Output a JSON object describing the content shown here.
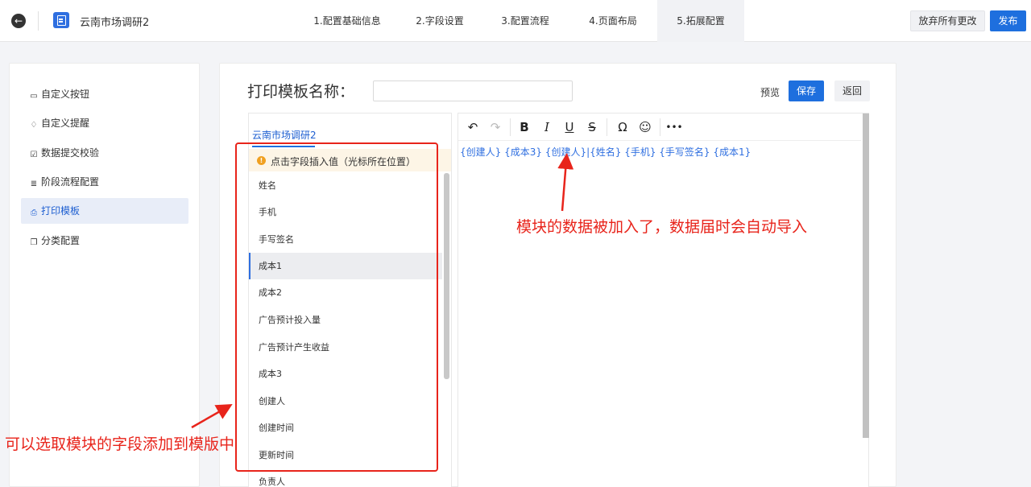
{
  "header": {
    "app_title": "云南市场调研2",
    "steps": [
      {
        "label": "1.配置基础信息",
        "active": false
      },
      {
        "label": "2.字段设置",
        "active": false
      },
      {
        "label": "3.配置流程",
        "active": false
      },
      {
        "label": "4.页面布局",
        "active": false
      },
      {
        "label": "5.拓展配置",
        "active": true
      }
    ],
    "discard_label": "放弃所有更改",
    "publish_label": "发布"
  },
  "sidebar": {
    "items": [
      {
        "label": "自定义按钮",
        "icon": "button-icon",
        "active": false
      },
      {
        "label": "自定义提醒",
        "icon": "bell-icon",
        "active": false
      },
      {
        "label": "数据提交校验",
        "icon": "check-icon",
        "active": false
      },
      {
        "label": "阶段流程配置",
        "icon": "flow-icon",
        "active": false
      },
      {
        "label": "打印模板",
        "icon": "printer-icon",
        "active": true
      },
      {
        "label": "分类配置",
        "icon": "category-icon",
        "active": false
      }
    ]
  },
  "main": {
    "template_name_label": "打印模板名称：",
    "template_name_value": "",
    "preview_label": "预览",
    "save_label": "保存",
    "return_label": "返回"
  },
  "field_panel": {
    "tab_label": "云南市场调研2",
    "notice": "点击字段插入值（光标所在位置）",
    "fields": [
      {
        "label": "姓名",
        "active": false
      },
      {
        "label": "手机",
        "active": false
      },
      {
        "label": "手写签名",
        "active": false
      },
      {
        "label": "成本1",
        "active": true
      },
      {
        "label": "成本2",
        "active": false
      },
      {
        "label": "广告预计投入量",
        "active": false
      },
      {
        "label": "广告预计产生收益",
        "active": false
      },
      {
        "label": "成本3",
        "active": false
      },
      {
        "label": "创建人",
        "active": false
      },
      {
        "label": "创建时间",
        "active": false
      },
      {
        "label": "更新时间",
        "active": false
      },
      {
        "label": "负责人",
        "active": false
      }
    ]
  },
  "editor": {
    "toolbar": [
      "undo-icon",
      "redo-icon",
      "bold-icon",
      "italic-icon",
      "underline-icon",
      "strikethrough-icon",
      "omega-icon",
      "emoji-icon",
      "more-icon"
    ],
    "content": "{创建人} {成本3} {创建人}|{姓名} {手机} {手写签名} {成本1}"
  },
  "annotations": {
    "right_text": "模块的数据被加入了，数据届时会自动导入",
    "left_text": "可以选取模块的字段添加到模版中",
    "color": "#e8241b"
  }
}
